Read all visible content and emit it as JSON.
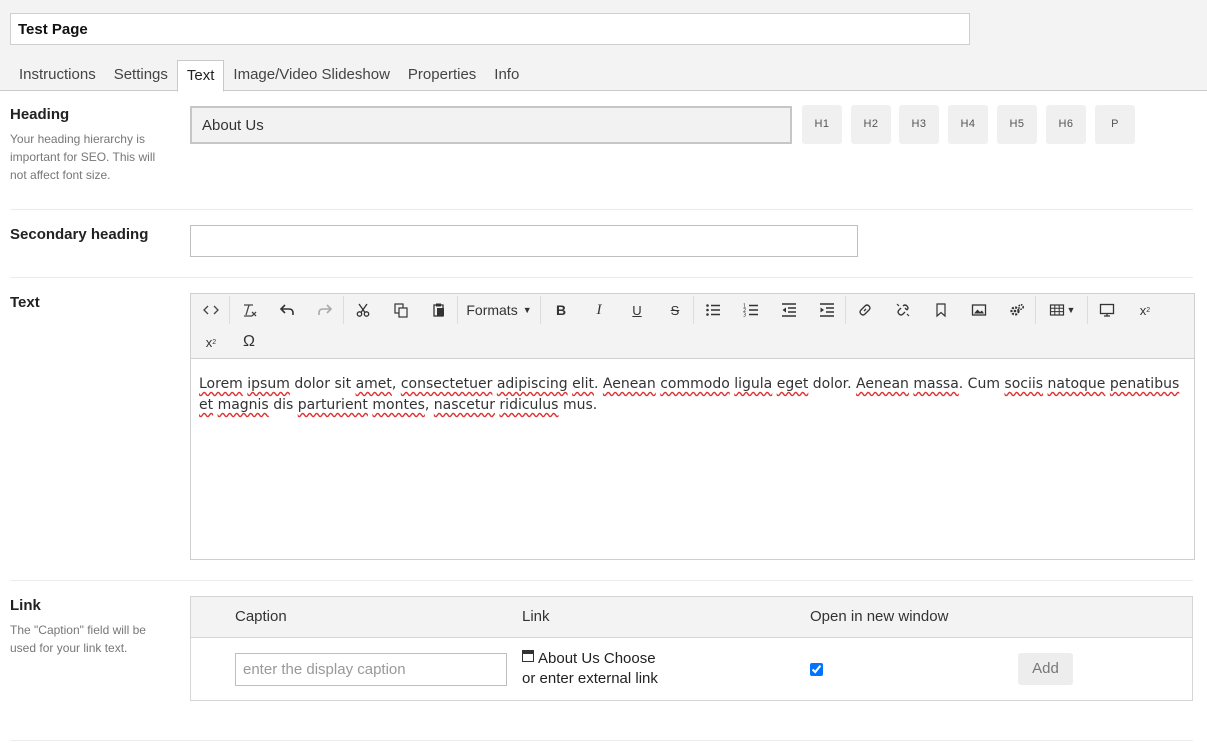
{
  "page": {
    "title_value": "Test Page"
  },
  "tabs": [
    "Instructions",
    "Settings",
    "Text",
    "Image/Video Slideshow",
    "Properties",
    "Info"
  ],
  "active_tab": "Text",
  "heading": {
    "label": "Heading",
    "help": "Your heading hierarchy is important for SEO. This will not affect font size.",
    "value": "About Us",
    "levels": [
      "H1",
      "H2",
      "H3",
      "H4",
      "H5",
      "H6",
      "P"
    ]
  },
  "secondary_heading": {
    "label": "Secondary heading",
    "value": ""
  },
  "text": {
    "label": "Text",
    "toolbar": {
      "formats_label": "Formats",
      "icons": [
        "source-code-icon",
        "clear-formatting-icon",
        "undo-icon",
        "redo-icon",
        "cut-icon",
        "copy-icon",
        "paste-icon",
        "formats-dropdown",
        "bold-icon",
        "italic-icon",
        "underline-icon",
        "strikethrough-icon",
        "bullet-list-icon",
        "numbered-list-icon",
        "outdent-icon",
        "indent-icon",
        "link-icon",
        "unlink-icon",
        "anchor-icon",
        "image-icon",
        "settings-icon",
        "table-icon",
        "preview-icon",
        "subscript-icon",
        "superscript-icon",
        "special-character-icon"
      ]
    },
    "content": {
      "w1": "Lorem",
      "w2": "ipsum",
      "w3": "dolor sit",
      "w4": "amet",
      "w5": ",",
      "w6": "consectetuer",
      "w7": "adipiscing",
      "w8": "elit",
      "w9": ".",
      "w10": "Aenean",
      "w11": "commodo",
      "w12": "ligula",
      "w13": "eget",
      "w14": "dolor.",
      "w15": "Aenean",
      "w16": "massa",
      "w17": ". Cum",
      "w18": "sociis",
      "w19": "natoque",
      "w20": "penatibus",
      "w21": "et",
      "w22": "magnis",
      "w23": "dis",
      "w24": "parturient",
      "w25": "montes",
      "w26": ",",
      "w27": "nascetur",
      "w28": "ridiculus",
      "w29": "mus."
    }
  },
  "link": {
    "label": "Link",
    "help": "The \"Caption\" field will be used for your link text.",
    "columns": [
      "Caption",
      "Link",
      "Open in new window"
    ],
    "caption_placeholder": "enter the display caption",
    "link_page": "About Us",
    "choose_label": "Choose",
    "external_label": "or enter external link",
    "open_new_window": true,
    "add_label": "Add"
  }
}
